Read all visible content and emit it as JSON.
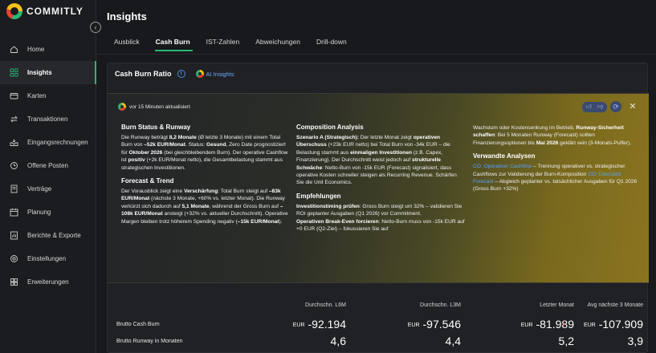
{
  "app": {
    "logo_text": "COMMITLY"
  },
  "sidebar": {
    "items": [
      {
        "label": "Home",
        "icon": "home-icon"
      },
      {
        "label": "Insights",
        "icon": "grid-icon",
        "active": true
      },
      {
        "label": "Karten",
        "icon": "card-icon"
      },
      {
        "label": "Transaktionen",
        "icon": "transactions-icon"
      },
      {
        "label": "Eingangsrechnungen",
        "icon": "inbox-icon"
      },
      {
        "label": "Offene Posten",
        "icon": "open-items-icon"
      },
      {
        "label": "Verträge",
        "icon": "contract-icon"
      },
      {
        "label": "Planung",
        "icon": "planning-icon"
      },
      {
        "label": "Berichte & Exporte",
        "icon": "reports-icon"
      },
      {
        "label": "Einstellungen",
        "icon": "gear-icon"
      },
      {
        "label": "Erweiterungen",
        "icon": "extensions-icon"
      }
    ]
  },
  "page": {
    "title": "Insights",
    "tabs": [
      {
        "label": "Ausblick"
      },
      {
        "label": "Cash Burn",
        "active": true
      },
      {
        "label": "IST-Zahlen"
      },
      {
        "label": "Abweichungen"
      },
      {
        "label": "Drill-down"
      }
    ]
  },
  "card": {
    "title": "Cash Burn Ratio",
    "ai_label": "AI Insights",
    "updated": "vor 15 Minuten aktualisiert",
    "col1": {
      "h1": "Burn Status & Runway",
      "p1": [
        "Die Runway beträgt ",
        "8,2 Monate",
        " (Ø letzte 3 Monate) mit einem Total Burn von ",
        "–52k EUR/Monat",
        ". Status: ",
        "Gesund",
        ", Zero Date prognostiziert für ",
        "Oktober 2026",
        " (bei gleichbleibendem Burn). Der operative Cashflow ist ",
        "positiv",
        " (+2k EUR/Monat netto), die Gesamtbelastung stammt aus strategischen Investitionen."
      ],
      "h2": "Forecast & Trend",
      "p2": [
        "Der Vorausblick zeigt eine ",
        "Verschärfung",
        ": Total Burn steigt auf ",
        "–83k EUR/Monat",
        " (nächste 3 Monate, +60% vs. letzter Monat). Die Runway verkürzt sich dadurch auf ",
        "5,1 Monate",
        ", während der Gross Burn auf ",
        "–108k EUR/Monat",
        " ansteigt (+32% vs. aktueller Durchschnitt). Operative Margen bleiben trotz höherem Spending negativ (",
        "–15k EUR/Monat",
        ")."
      ]
    },
    "col2": {
      "h1": "Composition Analysis",
      "p1": [
        "Szenario A (Strategisch):",
        " Der letzte Monat zeigt ",
        "operativen Überschuss",
        " (+23k EUR netto) bei Total Burn von -34k EUR – die Belastung stammt aus ",
        "einmaligen Investitionen",
        " (z.B. Capex, Finanzierung). Der Durchschnitt weist jedoch auf ",
        "strukturelle Schwäche",
        ": Netto-Burn von -15k EUR (Forecast) signalisiert, dass operative Kosten schneller steigen als Recurring Revenue. Schärfen Sie die Unit Economics."
      ],
      "h2": "Empfehlungen",
      "p2": [
        "Investitionstiming prüfen",
        ": Gross Burn steigt um 32% – validieren Sie ROI geplanter Ausgaben (Q1 2026) vor Commitment."
      ],
      "p3": [
        "Operativen Break-Even forcieren",
        ": Netto-Burn muss von -15k EUR auf +0 EUR (Q2-Ziel) – fokussieren Sie auf"
      ]
    },
    "col3": {
      "p1": [
        "Wachstum oder Kostensenkung im Betrieb. ",
        "Runway-Sicherheit schaffen",
        ": Bei 5 Monaten Runway (Forecast) sollten Finanzierungsoptionen bis ",
        "Mai 2026",
        " geklärt sein (3-Monats-Puffer)."
      ],
      "h2": "Verwandte Analysen",
      "p2": [
        "CO: Operativer Cashflow",
        " – Trennung operativer vs. strategischer Cashflows zur Validierung der Burn-Komposition ",
        "CO: Übersicht Forecast",
        " – Abgleich geplanter vs. tatsächlicher Ausgaben für Q1 2026 (Gross Burn +32%)"
      ]
    }
  },
  "stats": {
    "headers": [
      "Durchschn. L6M",
      "Durchschn. L3M",
      "Letzter Monat",
      "Avg nächste 3 Monate"
    ],
    "rows": [
      {
        "label": "Brutto Cash Burn",
        "currency": "EUR",
        "values": [
          "-92.194",
          "-97.546",
          "-81.989",
          "-107.909"
        ]
      },
      {
        "label": "Brutto Runway in Monaten",
        "values": [
          "4,6",
          "4,4",
          "5,2",
          "3,9"
        ]
      }
    ],
    "trend_icon": "arrow-down-icon",
    "trend_color": "#e8442e"
  },
  "colors": {
    "accent": "#2bb673",
    "link": "#5aa0ff",
    "negative": "#e8442e"
  }
}
